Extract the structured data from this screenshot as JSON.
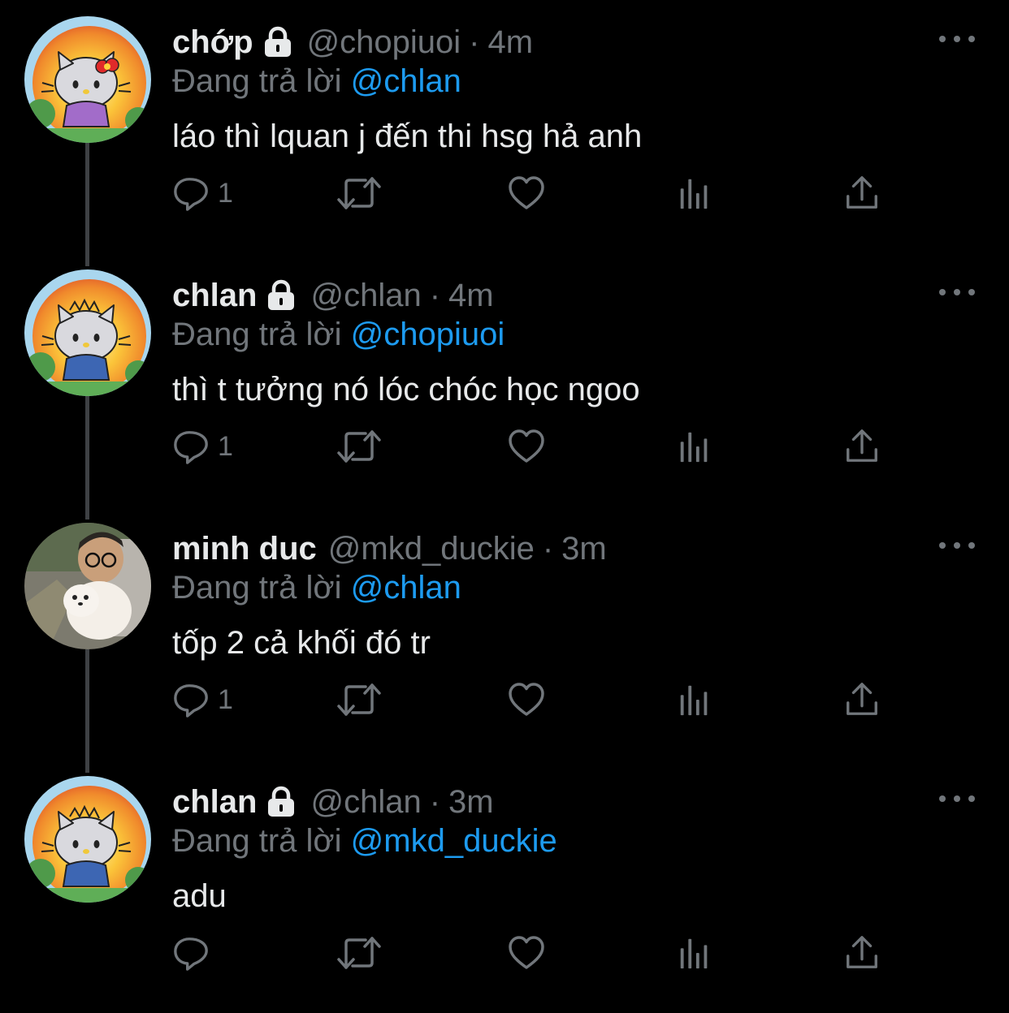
{
  "colors": {
    "background": "#000000",
    "primary_text": "#e7e9ea",
    "secondary_text": "#71767b",
    "link": "#1d9bf0",
    "thread_line": "#3e4144"
  },
  "reply_prefix": "Đang trả lời",
  "tweets": [
    {
      "avatar": "hello-kitty-purple-avatar",
      "name": "chớp",
      "protected": true,
      "handle": "@chopiuoi",
      "separator": "·",
      "time": "4m",
      "reply_to": "@chlan",
      "text": "láo thì lquan j đến thi hsg hả anh",
      "reply_count": "1"
    },
    {
      "avatar": "hello-kitty-blue-avatar",
      "name": "chlan",
      "protected": true,
      "handle": "@chlan",
      "separator": "·",
      "time": "4m",
      "reply_to": "@chopiuoi",
      "text": "thì t tưởng nó lóc chóc học ngoo",
      "reply_count": "1"
    },
    {
      "avatar": "photo-person-with-dog-avatar",
      "name": "minh duc",
      "protected": false,
      "handle": "@mkd_duckie",
      "separator": "·",
      "time": "3m",
      "reply_to": "@chlan",
      "text": "tốp 2 cả khối đó tr",
      "reply_count": "1"
    },
    {
      "avatar": "hello-kitty-blue-avatar",
      "name": "chlan",
      "protected": true,
      "handle": "@chlan",
      "separator": "·",
      "time": "3m",
      "reply_to": "@mkd_duckie",
      "text": "adu",
      "reply_count": ""
    }
  ]
}
